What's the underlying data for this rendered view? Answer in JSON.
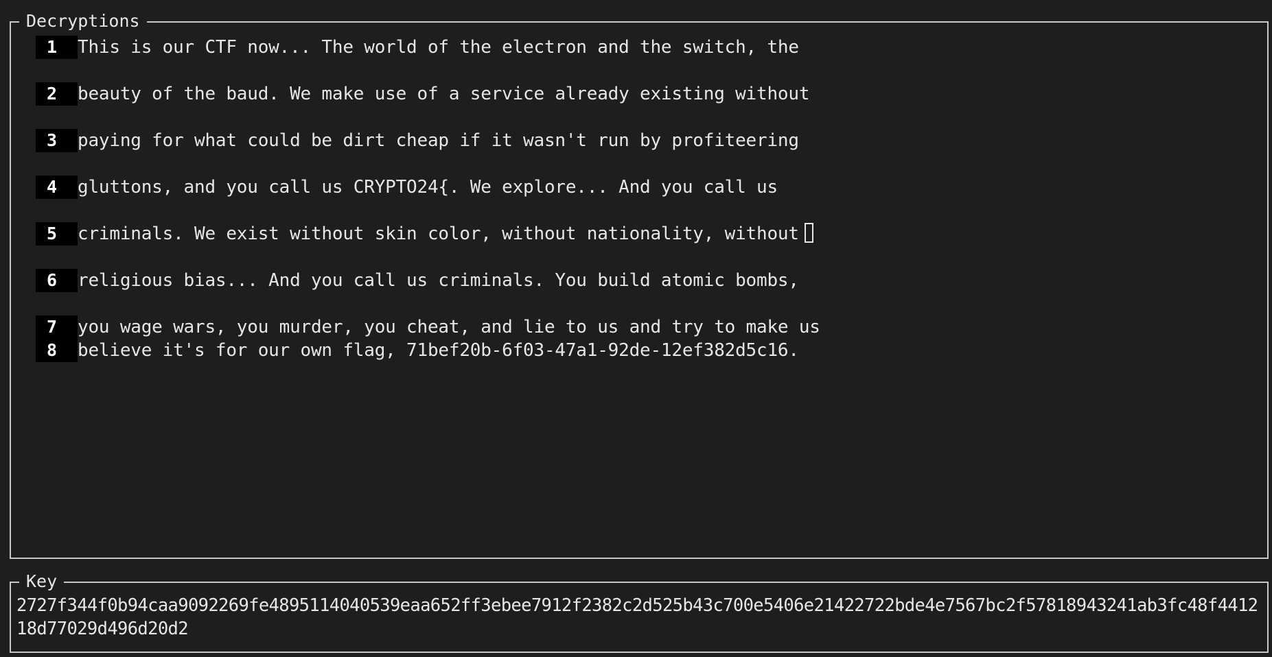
{
  "decryptions": {
    "title": "Decryptions",
    "lines": [
      {
        "num": "1",
        "text": "This is our CTF now... The world of the electron and the switch, the"
      },
      {
        "num": "2",
        "text": "beauty of the baud. We make use of a service already existing without"
      },
      {
        "num": "3",
        "text": "paying for what could be dirt cheap if it wasn't run by profiteering"
      },
      {
        "num": "4",
        "text": "gluttons, and you call us CRYPTO24{. We explore... And you call us"
      },
      {
        "num": "5",
        "text": "criminals. We exist without skin color, without nationality, without"
      },
      {
        "num": "6",
        "text": "religious bias... And you call us criminals. You build atomic bombs,"
      },
      {
        "num": "7",
        "text": "you wage wars, you murder, you cheat, and lie to us and try to make us"
      },
      {
        "num": "8",
        "text": "believe it's for our own flag, 71bef20b-6f03-47a1-92de-12ef382d5c16."
      }
    ]
  },
  "key": {
    "title": "Key",
    "value": "2727f344f0b94caa9092269fe4895114040539eaa652ff3ebee7912f2382c2d525b43c700e5406e21422722bde4e7567bc2f57818943241ab3fc48f441218d77029d496d20d2"
  }
}
